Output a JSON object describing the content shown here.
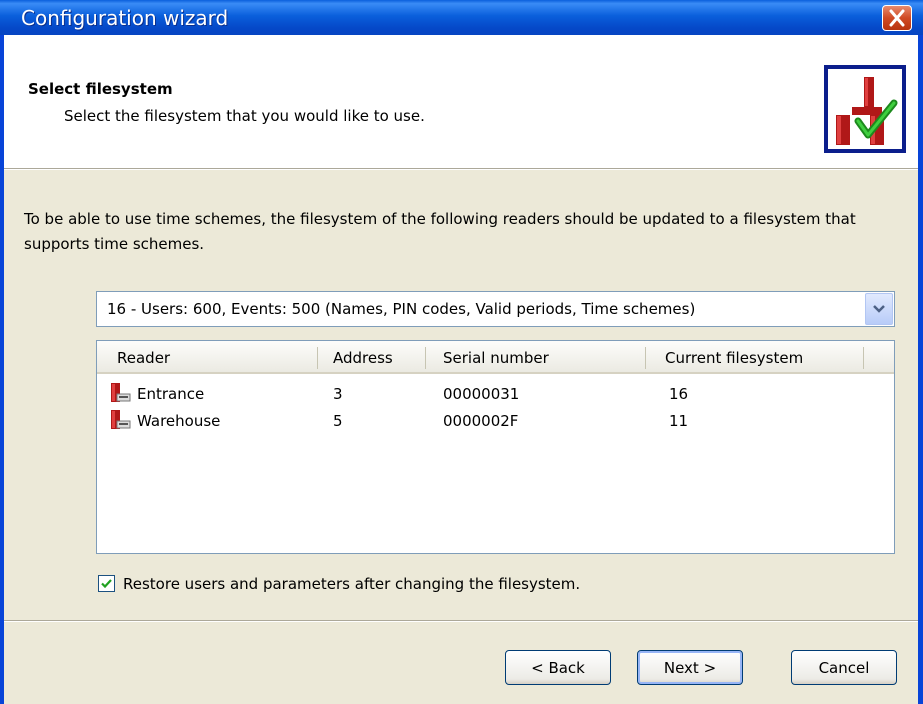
{
  "window": {
    "title": "Configuration wizard"
  },
  "header": {
    "title": "Select filesystem",
    "subtitle": "Select the filesystem that you would like to use."
  },
  "description": "To be able to use time schemes, the filesystem of the following readers should be updated to a filesystem that supports time schemes.",
  "filesystem_select": {
    "value": "16 - Users: 600, Events: 500 (Names, PIN codes, Valid periods, Time schemes)"
  },
  "readers_table": {
    "columns": [
      "Reader",
      "Address",
      "Serial number",
      "Current filesystem"
    ],
    "rows": [
      {
        "reader": "Entrance",
        "address": "3",
        "serial": "00000031",
        "filesystem": "16"
      },
      {
        "reader": "Warehouse",
        "address": "5",
        "serial": "0000002F",
        "filesystem": "11"
      }
    ]
  },
  "restore_option": {
    "label": "Restore users and parameters after changing the filesystem.",
    "checked": true
  },
  "buttons": {
    "back": "< Back",
    "next": "Next >",
    "cancel": "Cancel"
  },
  "icons": {
    "header": "reader-update-icon",
    "row": "card-reader-icon",
    "close": "close-icon",
    "dropdown": "chevron-down-icon",
    "check": "checkmark-icon"
  },
  "colors": {
    "titlebar": "#0a5fdc",
    "close": "#d04a24",
    "check": "#21a121"
  }
}
